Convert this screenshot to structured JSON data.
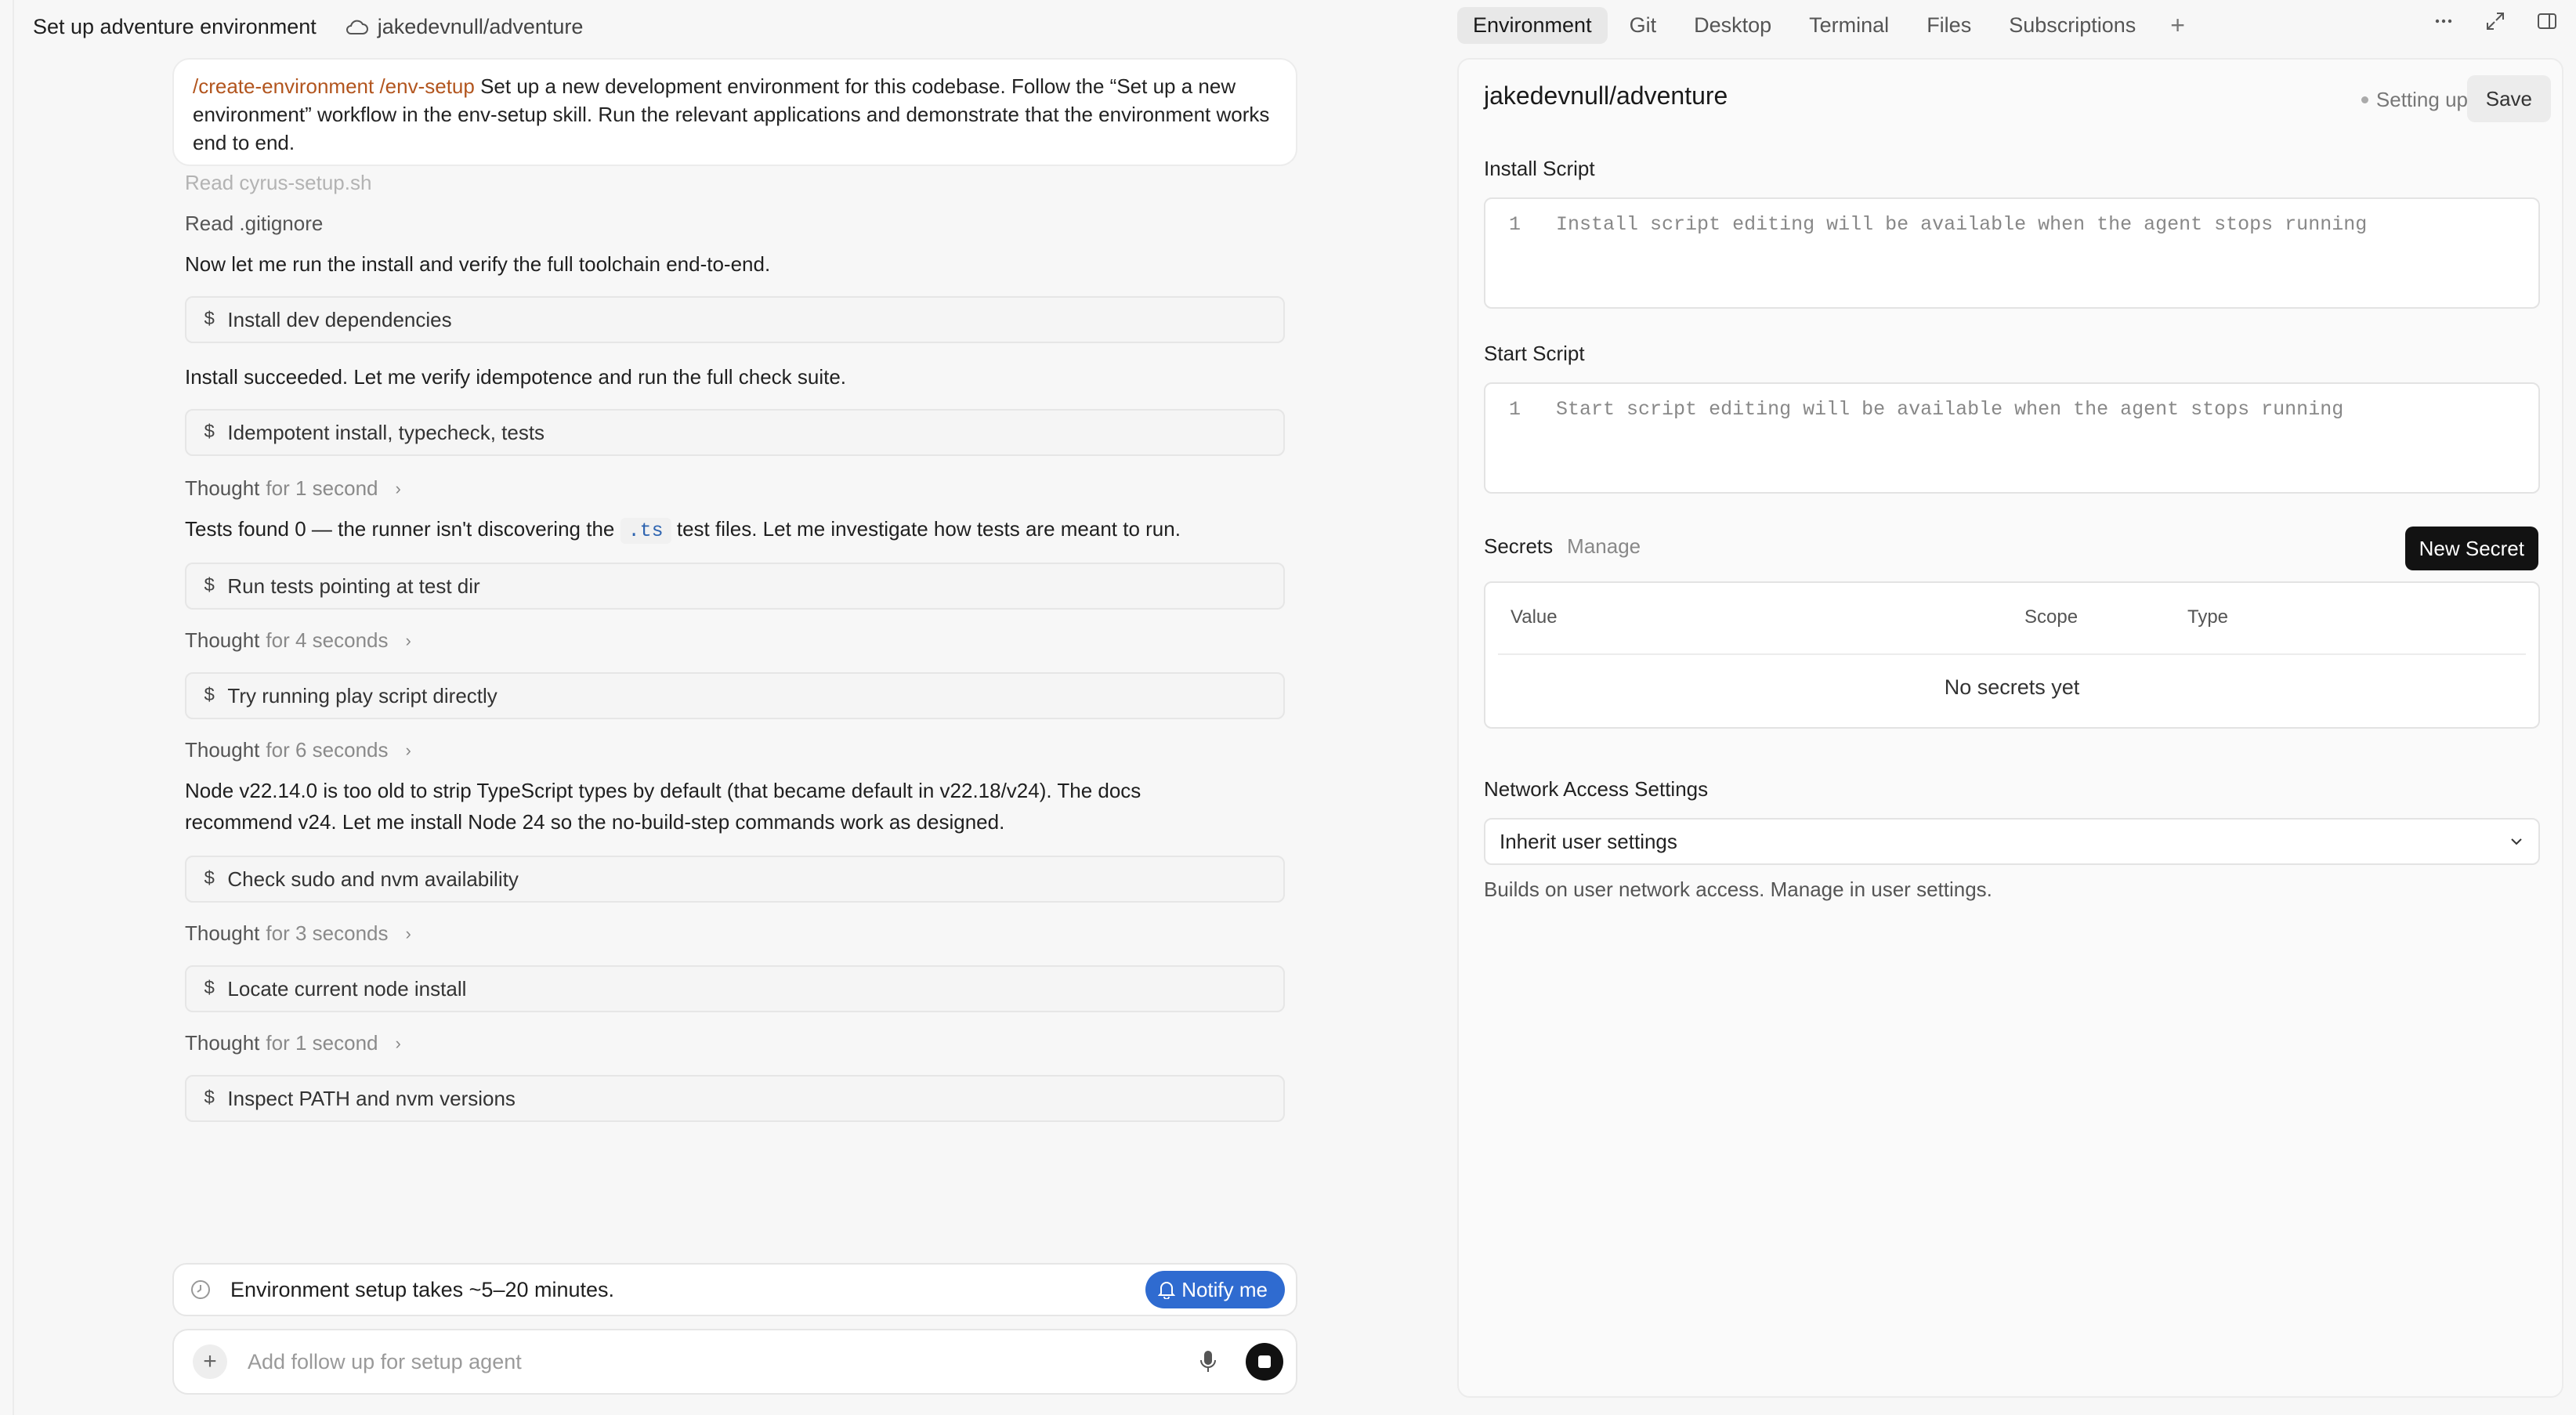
{
  "header": {
    "title": "Set up adventure environment",
    "repo": "jakedevnull/adventure",
    "repo_icon": "cloud-icon"
  },
  "chat": {
    "prompt": {
      "commands": "/create-environment /env-setup",
      "text": "Set up a new development environment for this codebase. Follow the “Set up a new environment” workflow in the env-setup skill. Run the relevant applications and demonstrate that the environment works end to end."
    },
    "read_faded": "Read cyrus-setup.sh",
    "read_gitignore": "Read .gitignore",
    "msg_install": "Now let me run the install and verify the full toolchain end-to-end.",
    "bash_1": "Install dev dependencies",
    "msg_succeeded": "Install succeeded. Let me verify idempotence and run the full check suite.",
    "bash_2": "Idempotent install, typecheck, tests",
    "thought_1": {
      "label": "Thought",
      "duration": "for 1 second"
    },
    "msg_tests": {
      "before": "Tests found 0 — the runner isn't discovering the",
      "code": ".ts",
      "after": "test files. Let me investigate how tests are meant to run."
    },
    "bash_3": "Run tests pointing at test dir",
    "thought_2": {
      "label": "Thought",
      "duration": "for 4 seconds"
    },
    "bash_4": "Try running play script directly",
    "thought_3": {
      "label": "Thought",
      "duration": "for 6 seconds"
    },
    "msg_node_1": "Node v22.14.0 is too old to strip TypeScript types by default (that became default in v22.18/v24). The docs",
    "msg_node_2": "recommend v24. Let me install Node 24 so the no-build-step commands work as designed.",
    "bash_5": "Check sudo and nvm availability",
    "thought_4": {
      "label": "Thought",
      "duration": "for 3 seconds"
    },
    "bash_6": "Locate current node install",
    "thought_5": {
      "label": "Thought",
      "duration": "for 1 second"
    },
    "bash_7": "Inspect PATH and nvm versions",
    "dollar": "$",
    "notice": "Environment setup takes ~5–20 minutes.",
    "notify_label": "Notify me",
    "composer_placeholder": "Add follow up for setup agent"
  },
  "tabs": [
    {
      "label": "Environment",
      "active": true
    },
    {
      "label": "Git"
    },
    {
      "label": "Desktop"
    },
    {
      "label": "Terminal"
    },
    {
      "label": "Files"
    },
    {
      "label": "Subscriptions"
    }
  ],
  "top_icons": [
    "more-icon",
    "expand-icon",
    "sidebar-toggle-icon"
  ],
  "env": {
    "title": "jakedevnull/adventure",
    "status": "Setting up",
    "save_label": "Save",
    "install_label": "Install Script",
    "install_line": "1",
    "install_text": "Install script editing will be available when the agent stops running",
    "start_label": "Start Script",
    "start_line": "1",
    "start_text": "Start script editing will be available when the agent stops running",
    "secrets_label": "Secrets",
    "manage_label": "Manage",
    "new_secret_label": "New Secret",
    "secrets_table": {
      "headers": [
        "Value",
        "Scope",
        "Type"
      ],
      "empty": "No secrets yet"
    },
    "network_label": "Network Access Settings",
    "network_value": "Inherit user settings",
    "help_prefix": "Builds on user network access. Manage in",
    "help_link": "user",
    "help_suffix": "settings."
  }
}
